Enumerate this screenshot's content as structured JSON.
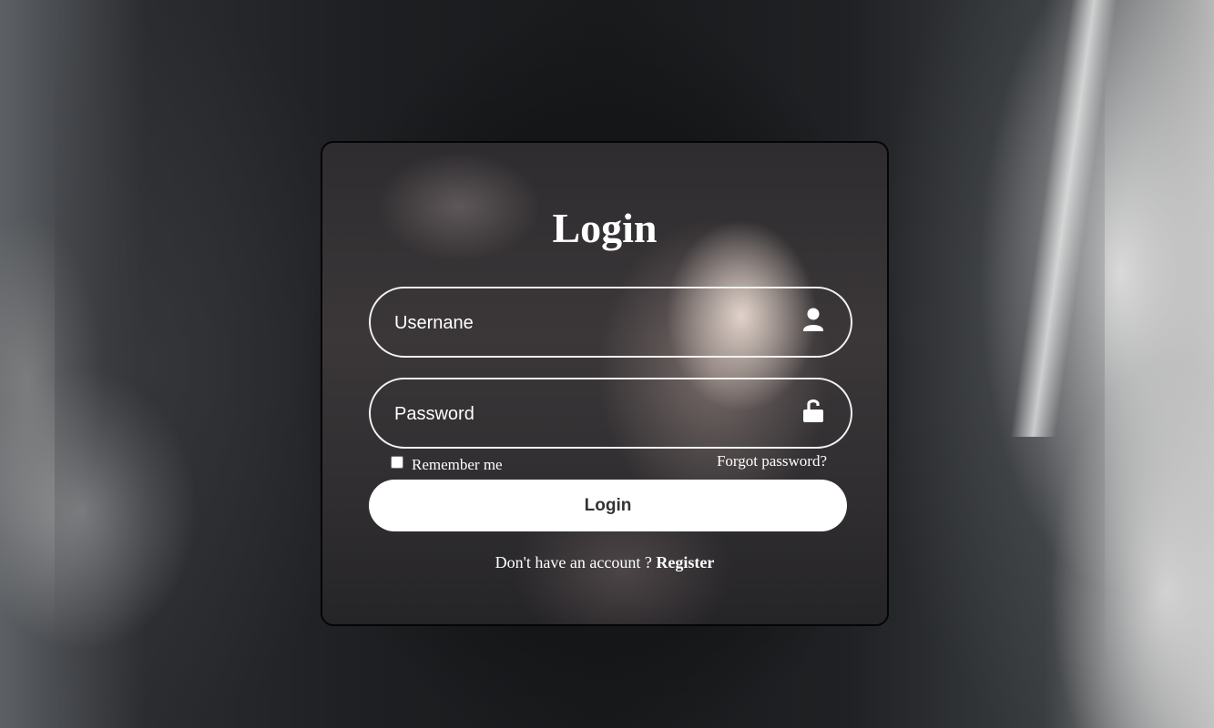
{
  "form": {
    "title": "Login",
    "username": {
      "placeholder": "Usernane",
      "value": "",
      "icon": "user-icon"
    },
    "password": {
      "placeholder": "Password",
      "value": "",
      "icon": "unlocked-padlock-icon"
    },
    "remember_label": "Remember me",
    "remember_checked": false,
    "forgot_label": "Forgot password?",
    "submit_label": "Login",
    "register_prompt": "Don't have an account ?",
    "register_link": "Register"
  },
  "colors": {
    "card_border": "#050505",
    "text": "#ffffff",
    "button_background": "#ffffff",
    "button_text": "#333333"
  }
}
